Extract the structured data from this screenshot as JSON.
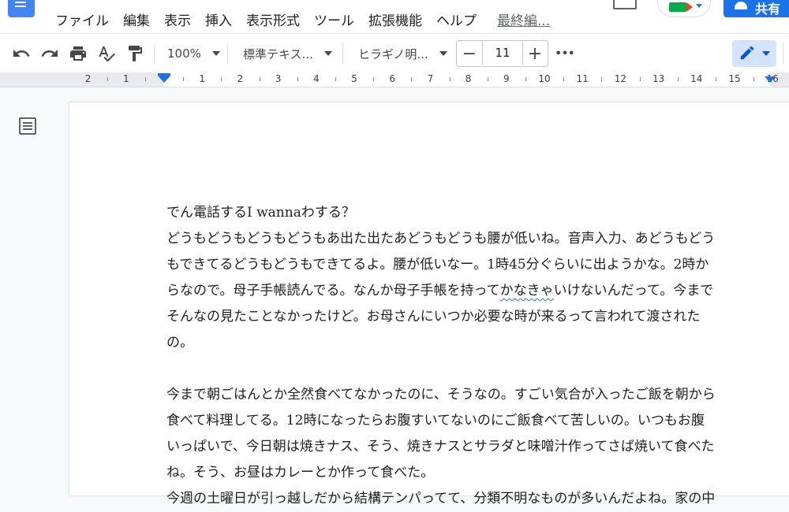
{
  "menubar": {
    "items": [
      "ファイル",
      "編集",
      "表示",
      "挿入",
      "表示形式",
      "ツール",
      "拡張機能",
      "ヘルプ"
    ],
    "last_edit": "最終編..."
  },
  "header": {
    "share_label": "共有"
  },
  "toolbar": {
    "zoom": "100%",
    "style": "標準テキス...",
    "font": "ヒラギノ明...",
    "font_size": "11",
    "minus": "−",
    "plus": "+",
    "more": "•••"
  },
  "ruler": {
    "labels": [
      "2",
      "1",
      "1",
      "2",
      "3",
      "4",
      "5",
      "6",
      "7",
      "8",
      "9",
      "10",
      "11",
      "12",
      "13",
      "14",
      "15",
      "16"
    ]
  },
  "document": {
    "lines": [
      {
        "before": "でん電話するI wannaわする？"
      },
      {
        "before": "どうもどうもどうもどうもあ出た出たあどうもどうも腰が低いね。音声入力、あどうもどう"
      },
      {
        "before": "もできてるどうもどうもできてるよ。腰が低いなー。1時45分ぐらいに出ようかな。2時か"
      },
      {
        "before": "らなので。母子手帳読んでる。なんか母子手帳を持って",
        "flag": "かなきゃ",
        "after": "いけないんだって。今まで"
      },
      {
        "before": "そんなの見たことなかったけど。お母さんにいつか必要な時が来るって言われて渡された"
      },
      {
        "before": "の。"
      },
      {
        "before": ""
      },
      {
        "before": "今まで朝ごはんとか全然食べてなかったのに、そうなの。すごい気合が入ったご飯を朝から"
      },
      {
        "before": "食べて料理してる。12時になったらお腹すいてないのにご飯食べて苦しいの。いつもお腹"
      },
      {
        "before": "いっぱいで、今日朝は焼きナス、そう、焼きナスとサラダと味噌汁作ってさば焼いて食べた"
      },
      {
        "before": "ね。そう、お昼はカレーとか作って食べた。"
      },
      {
        "before": "今週の土曜日が引っ越しだから結構テンパってて、分類不明なものが多いんだよね。家の中"
      }
    ]
  },
  "colors": {
    "accent": "#1a73e8",
    "edit_mode_bg": "#d3e3fd"
  },
  "icons": [
    "docs-logo-icon",
    "comment-icon",
    "meet-icon",
    "share-person-icon",
    "undo-icon",
    "redo-icon",
    "print-icon",
    "spellcheck-icon",
    "paint-format-icon",
    "edit-mode-pencil-icon",
    "outline-icon"
  ]
}
